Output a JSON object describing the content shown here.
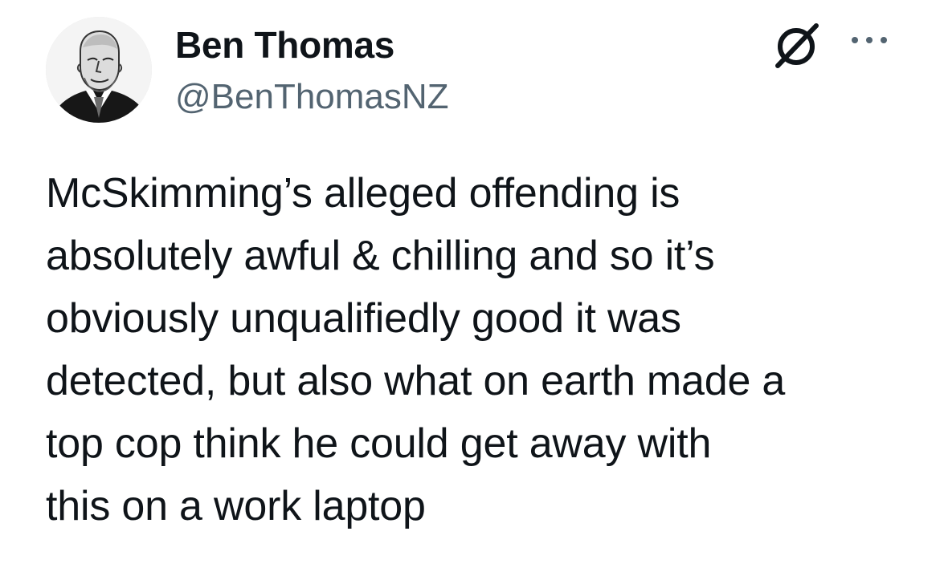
{
  "tweet": {
    "author": {
      "display_name": "Ben Thomas",
      "handle": "@BenThomasNZ",
      "avatar_icon": "profile-portrait-sketch"
    },
    "actions": {
      "grok_icon": "slashed-circle-icon",
      "more_icon": "more-options-dots-icon"
    },
    "text": "McSkimming’s alleged offending is\nabsolutely awful & chilling and so it’s\nobviously unqualifiedly good it was\ndetected, but also what on earth made a\ntop cop think he could get away with\nthis on a work laptop"
  },
  "colors": {
    "primary_text": "#0f1419",
    "secondary_text": "#536471",
    "background": "#ffffff"
  }
}
